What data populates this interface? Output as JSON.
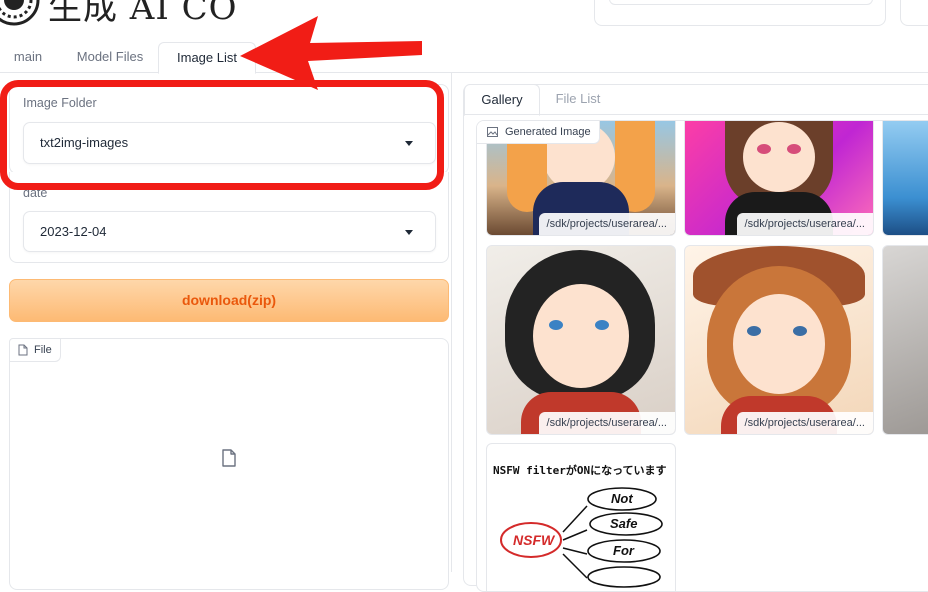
{
  "header": {
    "title": "生成 AI CO"
  },
  "tabs": [
    {
      "label": "main"
    },
    {
      "label": "Model Files"
    },
    {
      "label": "Image List"
    }
  ],
  "image_folder": {
    "label": "Image Folder",
    "value": "txt2img-images"
  },
  "date": {
    "label": "date",
    "value": "2023-12-04"
  },
  "download_button": "download(zip)",
  "file_box": {
    "label": "File"
  },
  "gallery": {
    "tabs": [
      {
        "label": "Gallery"
      },
      {
        "label": "File List"
      }
    ],
    "label": "Generated Image",
    "items": [
      {
        "caption": "/sdk/projects/userarea/..."
      },
      {
        "caption": "/sdk/projects/userarea/..."
      },
      {
        "caption": ""
      },
      {
        "caption": "/sdk/projects/userarea/..."
      },
      {
        "caption": "/sdk/projects/userarea/..."
      },
      {
        "caption": ""
      },
      {
        "caption": ""
      }
    ],
    "nsfw_note": {
      "title": "NSFW filterがONになっています",
      "center": "NSFW",
      "words": [
        "Not",
        "Safe",
        "For"
      ]
    }
  },
  "colors": {
    "accent_orange": "#ea580c",
    "annotation_red": "#f11d16"
  }
}
